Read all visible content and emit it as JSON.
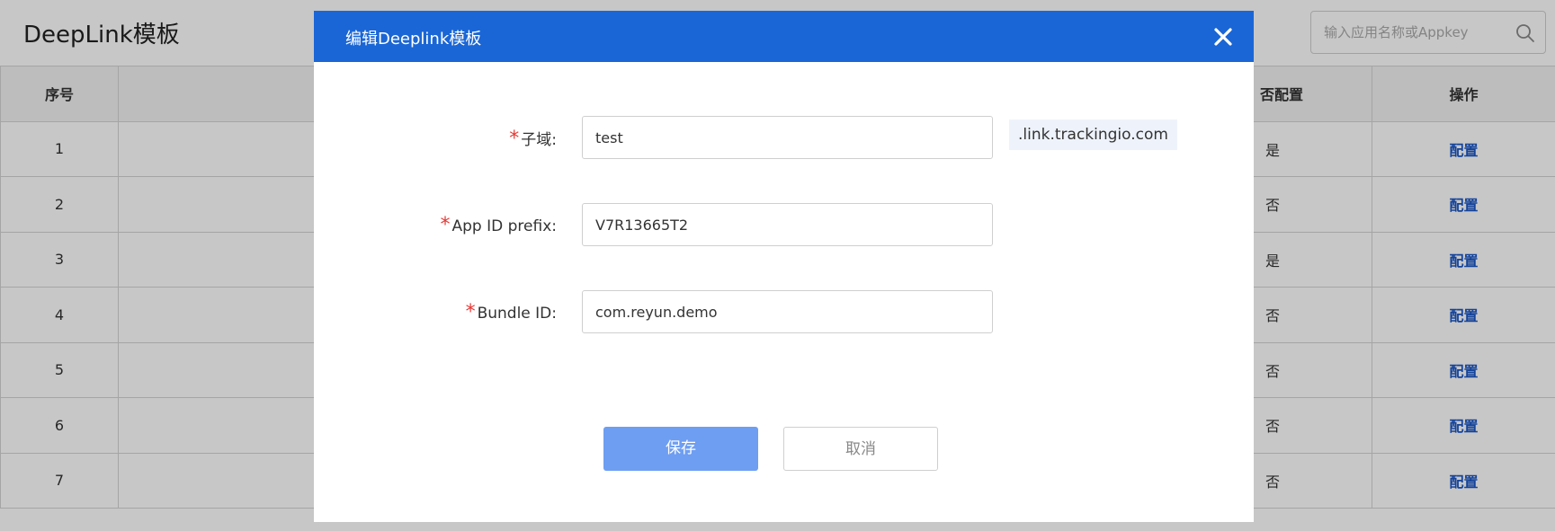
{
  "page": {
    "title": "DeepLink模板",
    "search": {
      "placeholder": "输入应用名称或Appkey",
      "value": ""
    }
  },
  "table": {
    "headers": {
      "seq": "序号",
      "configured": "否配置",
      "action": "操作"
    },
    "rows": [
      {
        "seq": "1",
        "configured": "是",
        "action": "配置"
      },
      {
        "seq": "2",
        "configured": "否",
        "action": "配置"
      },
      {
        "seq": "3",
        "configured": "是",
        "action": "配置"
      },
      {
        "seq": "4",
        "configured": "否",
        "action": "配置"
      },
      {
        "seq": "5",
        "configured": "否",
        "action": "配置"
      },
      {
        "seq": "6",
        "configured": "否",
        "action": "配置"
      },
      {
        "seq": "7",
        "configured": "否",
        "action": "配置"
      }
    ]
  },
  "modal": {
    "title": "编辑Deeplink模板",
    "fields": {
      "subdomain": {
        "required": "*",
        "label": "子域:",
        "value": "test",
        "suffix": ".link.trackingio.com"
      },
      "app_id_prefix": {
        "required": "*",
        "label": "App ID prefix:",
        "value": "V7R13665T2"
      },
      "bundle_id": {
        "required": "*",
        "label": "Bundle ID:",
        "value": "com.reyun.demo"
      }
    },
    "buttons": {
      "save": "保存",
      "cancel": "取消"
    }
  },
  "colors": {
    "header_blue": "#1a66d6",
    "save_button": "#6e9ef2",
    "link_blue": "#1a56c6",
    "required_red": "#e53935"
  }
}
